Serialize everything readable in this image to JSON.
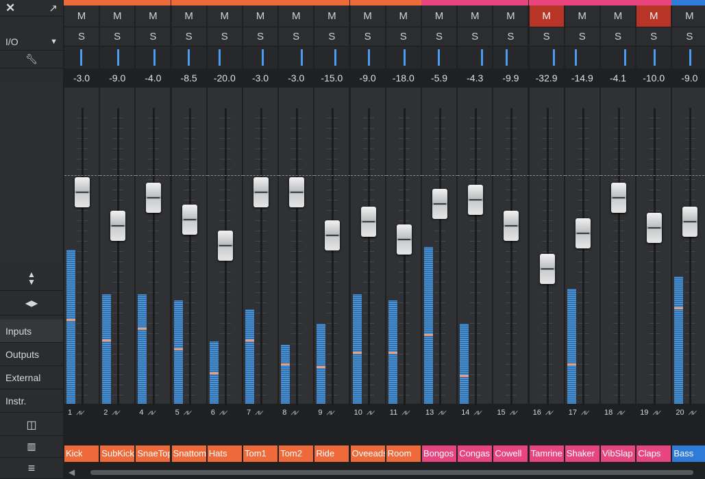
{
  "left_panel": {
    "close_icon": "x-icon",
    "expand_icon": "expand-arrow-icon",
    "io_label": "I/O",
    "io_dropdown_icon": "triangle-down-icon",
    "wrench_icon": "wrench-icon",
    "height_icon": "up-down-arrows-icon",
    "width_icon": "left-right-arrows-icon",
    "buttons": [
      "Inputs",
      "Outputs",
      "External",
      "Instr."
    ],
    "bottom_icons": [
      "stack-icon",
      "mixer-icon",
      "menu-icon"
    ]
  },
  "mute_label": "M",
  "solo_label": "S",
  "colors": {
    "drums": "#ef6a3a",
    "perc": "#e8457e",
    "bass": "#2f7bd8",
    "mute_on": "#b83426",
    "meter": "#4a92d6"
  },
  "channels": [
    {
      "number": "1",
      "name": "Kick",
      "value": "-3.0",
      "color": "#ef6a3a",
      "muted": false,
      "pan": 0.45,
      "fader": 0.65,
      "meter": 0.52,
      "peak": 0.28
    },
    {
      "number": "2",
      "name": "SubKick",
      "value": "-9.0",
      "color": "#ef6a3a",
      "muted": false,
      "pan": 0.5,
      "fader": 0.48,
      "meter": 0.37,
      "peak": 0.21
    },
    {
      "number": "4",
      "name": "SnaeTop",
      "value": "-4.0",
      "color": "#ef6a3a",
      "muted": false,
      "pan": 0.52,
      "fader": 0.62,
      "meter": 0.37,
      "peak": 0.25
    },
    {
      "number": "5",
      "name": "Snattom",
      "value": "-8.5",
      "color": "#ef6a3a",
      "muted": false,
      "pan": 0.45,
      "fader": 0.51,
      "meter": 0.35,
      "peak": 0.18
    },
    {
      "number": "6",
      "name": "Hats",
      "value": "-20.0",
      "color": "#ef6a3a",
      "muted": false,
      "pan": 0.3,
      "fader": 0.38,
      "meter": 0.21,
      "peak": 0.1
    },
    {
      "number": "7",
      "name": "Tom1",
      "value": "-3.0",
      "color": "#ef6a3a",
      "muted": false,
      "pan": 0.55,
      "fader": 0.65,
      "meter": 0.32,
      "peak": 0.21
    },
    {
      "number": "8",
      "name": "Tom2",
      "value": "-3.0",
      "color": "#ef6a3a",
      "muted": false,
      "pan": 0.65,
      "fader": 0.65,
      "meter": 0.2,
      "peak": 0.13
    },
    {
      "number": "9",
      "name": "Ride",
      "value": "-15.0",
      "color": "#ef6a3a",
      "muted": false,
      "pan": 0.6,
      "fader": 0.43,
      "meter": 0.27,
      "peak": 0.12
    },
    {
      "number": "10",
      "name": "Oveeads",
      "value": "-9.0",
      "color": "#ef6a3a",
      "muted": false,
      "pan": 0.5,
      "fader": 0.5,
      "meter": 0.37,
      "peak": 0.17
    },
    {
      "number": "11",
      "name": "Room",
      "value": "-18.0",
      "color": "#ef6a3a",
      "muted": false,
      "pan": 0.5,
      "fader": 0.41,
      "meter": 0.35,
      "peak": 0.17
    },
    {
      "number": "13",
      "name": "Bongos",
      "value": "-5.9",
      "color": "#e8457e",
      "muted": false,
      "pan": 0.45,
      "fader": 0.59,
      "meter": 0.53,
      "peak": 0.23
    },
    {
      "number": "14",
      "name": "Congas",
      "value": "-4.3",
      "color": "#e8457e",
      "muted": false,
      "pan": 0.7,
      "fader": 0.61,
      "meter": 0.27,
      "peak": 0.09
    },
    {
      "number": "15",
      "name": "Cowell",
      "value": "-9.9",
      "color": "#e8457e",
      "muted": false,
      "pan": 0.35,
      "fader": 0.48,
      "meter": 0,
      "peak": 0
    },
    {
      "number": "16",
      "name": "Tamrine",
      "value": "-32.9",
      "color": "#e8457e",
      "muted": true,
      "pan": 0.7,
      "fader": 0.26,
      "meter": 0,
      "peak": 0
    },
    {
      "number": "17",
      "name": "Shaker",
      "value": "-14.9",
      "color": "#e8457e",
      "muted": false,
      "pan": 0.25,
      "fader": 0.44,
      "meter": 0.39,
      "peak": 0.13
    },
    {
      "number": "18",
      "name": "VibSlap",
      "value": "-4.1",
      "color": "#e8457e",
      "muted": false,
      "pan": 0.7,
      "fader": 0.62,
      "meter": 0,
      "peak": 0
    },
    {
      "number": "19",
      "name": "Claps",
      "value": "-10.0",
      "color": "#e8457e",
      "muted": true,
      "pan": 0.5,
      "fader": 0.47,
      "meter": 0,
      "peak": 0
    },
    {
      "number": "20",
      "name": "Bass",
      "value": "-9.0",
      "color": "#2f7bd8",
      "muted": false,
      "pan": 0.5,
      "fader": 0.5,
      "meter": 0.43,
      "peak": 0.32
    }
  ]
}
